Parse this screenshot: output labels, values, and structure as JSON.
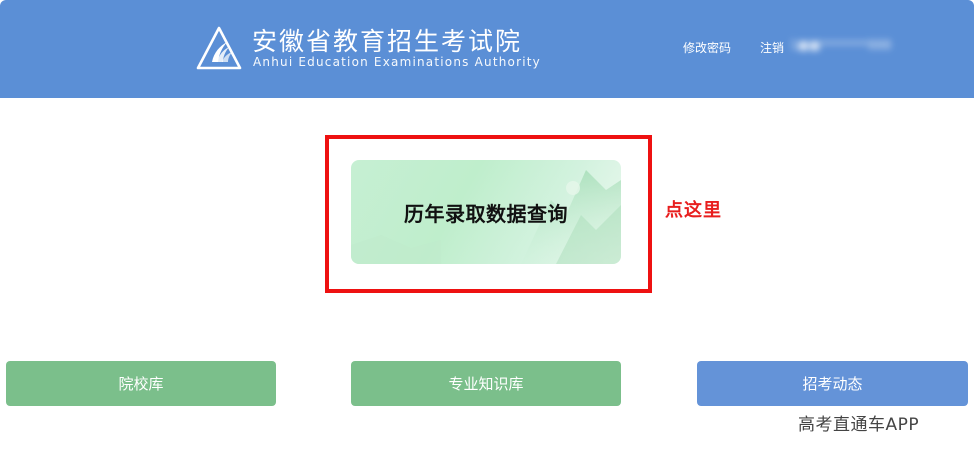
{
  "header": {
    "org_name_cn": "安徽省教育招生考试院",
    "org_name_en": "Anhui Education Examinations Authority",
    "logo_icon": "aeea-logo-icon",
    "change_password_label": "修改密码",
    "logout_label": "注销",
    "user_display": "1■■********888",
    "background_color": "#5b8fd6"
  },
  "main": {
    "history_card_title": "历年录取数据查询",
    "annotation_label": "点这里",
    "annotation_color": "#e81e1e"
  },
  "buttons": {
    "schools_label": "院校库",
    "majors_label": "专业知识库",
    "admission_news_label": "招考动态",
    "green_color": "#7bbf8b",
    "blue_color": "#6493d8"
  },
  "watermark": {
    "text": "高考直通车APP"
  }
}
